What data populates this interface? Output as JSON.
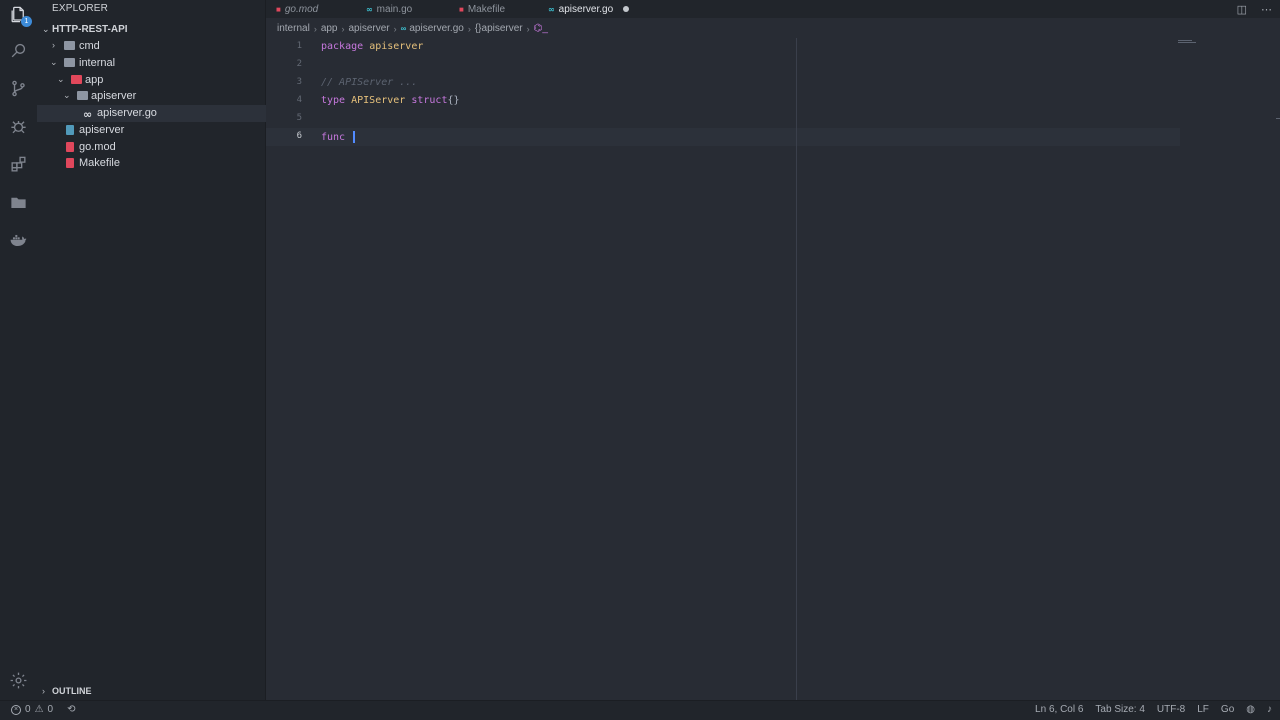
{
  "sidebar": {
    "title": "EXPLORER",
    "project": "HTTP-REST-API",
    "tree": [
      {
        "label": "cmd"
      },
      {
        "label": "internal"
      },
      {
        "label": "app"
      },
      {
        "label": "apiserver"
      },
      {
        "label": "apiserver.go"
      },
      {
        "label": "apiserver"
      },
      {
        "label": "go.mod"
      },
      {
        "label": "Makefile"
      }
    ],
    "outline": "OUTLINE"
  },
  "activity_bar": {
    "explorer_badge": "1",
    "icons": [
      "files-icon",
      "search-icon",
      "source-control-icon",
      "debug-icon",
      "extensions-icon",
      "folder-icon",
      "docker-icon",
      "gear-icon"
    ]
  },
  "tabs": [
    {
      "label": "go.mod"
    },
    {
      "label": "main.go"
    },
    {
      "label": "Makefile"
    },
    {
      "label": "apiserver.go"
    }
  ],
  "breadcrumb": [
    "internal",
    "app",
    "apiserver",
    "apiserver.go",
    "{}apiserver",
    "⌬_"
  ],
  "code": {
    "line_numbers": [
      "1",
      "2",
      "3",
      "4",
      "5",
      "6"
    ],
    "line1_kw": "package",
    "line1_name": "apiserver",
    "line3_comment": "// APIServer ...",
    "line4_kw1": "type",
    "line4_name": "APIServer",
    "line4_kw2": "struct",
    "line4_rest": "{}",
    "line6_kw": "func"
  },
  "status": {
    "errors": "0",
    "warnings": "0",
    "position": "Ln 6, Col 6",
    "tab_size": "Tab Size: 4",
    "encoding": "UTF-8",
    "eol": "LF",
    "language": "Go"
  },
  "colors": {
    "keyword": "#c678dd",
    "type": "#e5c07b",
    "comment": "#5c6370",
    "go_icon": "#3ec2d2"
  }
}
